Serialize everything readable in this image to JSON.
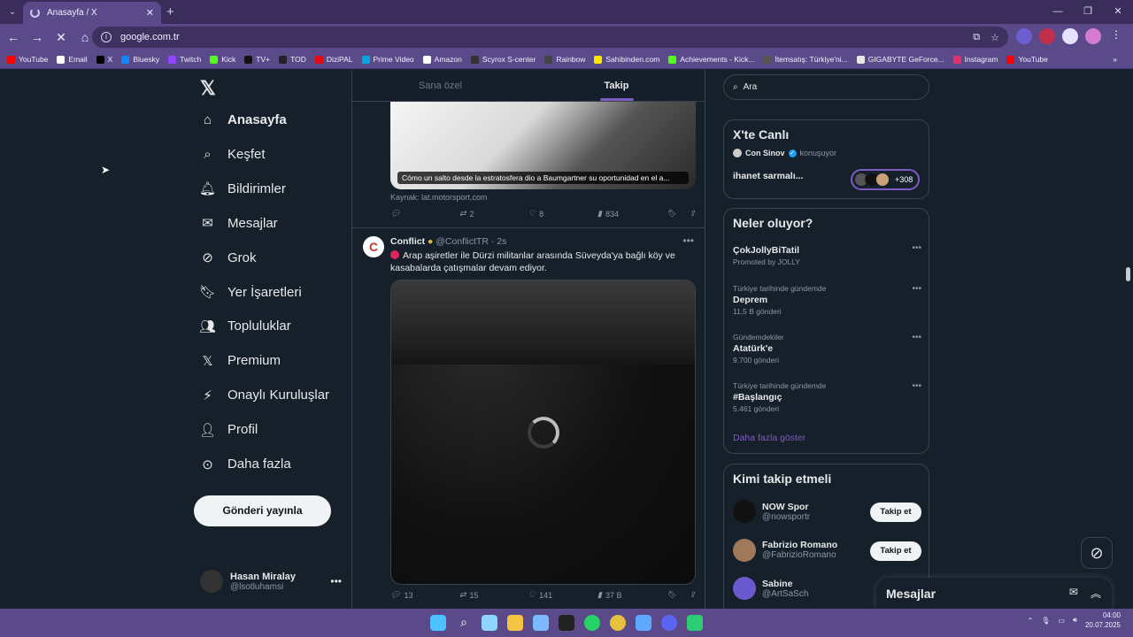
{
  "browser": {
    "tab_title": "Anasayfa / X",
    "url": "google.com.tr",
    "bookmarks": [
      "YouTube",
      "Email",
      "X",
      "Bluesky",
      "Twitch",
      "Kick",
      "TV+",
      "TOD",
      "DiziPAL",
      "Prime Video",
      "Amazon",
      "Scyrox S-center",
      "Rainbow",
      "Sahibinden.com",
      "Achievements - Kick...",
      "İtemsatış: Türkiye'ni...",
      "GIGABYTE GeForce...",
      "Instagram",
      "YouTube"
    ],
    "bookmark_colors": [
      "#ff0000",
      "#ffffff",
      "#000000",
      "#1185fe",
      "#9146ff",
      "#53fc18",
      "#111111",
      "#222222",
      "#e50914",
      "#00a8e1",
      "#ffffff",
      "#333333",
      "#444444",
      "#ffe800",
      "#53fc18",
      "#555555",
      "#e8e8e8",
      "#e1306c",
      "#ff0000"
    ]
  },
  "nav": {
    "items": [
      {
        "label": "Anasayfa",
        "icon": "home-icon"
      },
      {
        "label": "Keşfet",
        "icon": "search-icon"
      },
      {
        "label": "Bildirimler",
        "icon": "bell-icon"
      },
      {
        "label": "Mesajlar",
        "icon": "mail-icon"
      },
      {
        "label": "Grok",
        "icon": "grok-icon"
      },
      {
        "label": "Yer İşaretleri",
        "icon": "bookmark-icon"
      },
      {
        "label": "Topluluklar",
        "icon": "communities-icon"
      },
      {
        "label": "Premium",
        "icon": "x-icon"
      },
      {
        "label": "Onaylı Kuruluşlar",
        "icon": "lightning-icon"
      },
      {
        "label": "Profil",
        "icon": "person-icon"
      },
      {
        "label": "Daha fazla",
        "icon": "more-circle-icon"
      }
    ],
    "post_button": "Gönderi yayınla",
    "user": {
      "name": "Hasan Miralay",
      "handle": "@lsotluhamsi"
    }
  },
  "timeline": {
    "tabs": [
      "Sana özel",
      "Takip"
    ],
    "post1": {
      "caption": "Cómo un salto desde la estratosfera dio a Baumgartner su oportunidad en el a...",
      "source": "Kaynak: lat.motorsport.com",
      "replies": "",
      "reposts": "2",
      "likes": "8",
      "views": "834"
    },
    "post2": {
      "avatar_letter": "C",
      "name": "Conflict",
      "handle": "@ConflictTR",
      "time": "· 2s",
      "text": "Arap aşiretler ile Dürzi militanlar arasında Süveyda'ya bağlı köy ve kasabalarda çatışmalar devam ediyor.",
      "replies": "13",
      "reposts": "15",
      "likes": "141",
      "views": "37 B"
    }
  },
  "right": {
    "search_placeholder": "Ara",
    "live": {
      "title": "X'te Canlı",
      "host": "Con Sinov",
      "status": "konuşuyor",
      "space_title": "ihanet sarmalı...",
      "listeners": "+308"
    },
    "trends": {
      "title": "Neler oluyor?",
      "items": [
        {
          "meta": "",
          "topic": "ÇokJollyBiTatil",
          "count": "Promoted by JOLLY"
        },
        {
          "meta": "Türkiye tarihinde gündemde",
          "topic": "Deprem",
          "count": "11,5 B gönderi"
        },
        {
          "meta": "Gündemdekiler",
          "topic": "Atatürk'e",
          "count": "9.700 gönderi"
        },
        {
          "meta": "Türkiye tarihinde gündemde",
          "topic": "#Başlangıç",
          "count": "5.461 gönderi"
        }
      ],
      "show_more": "Daha fazla göster"
    },
    "who_to_follow": {
      "title": "Kimi takip etmeli",
      "items": [
        {
          "name": "NOW Spor",
          "handle": "@nowsportr",
          "button": "Takip et"
        },
        {
          "name": "Fabrizio Romano",
          "handle": "@FabrizioRomano",
          "button": "Takip et"
        },
        {
          "name": "Sabine",
          "handle": "@ArtSaSch",
          "button": ""
        }
      ]
    }
  },
  "messages_drawer": {
    "label": "Mesajlar"
  },
  "taskbar": {
    "time": "04:00",
    "date": "20.07.2025"
  }
}
